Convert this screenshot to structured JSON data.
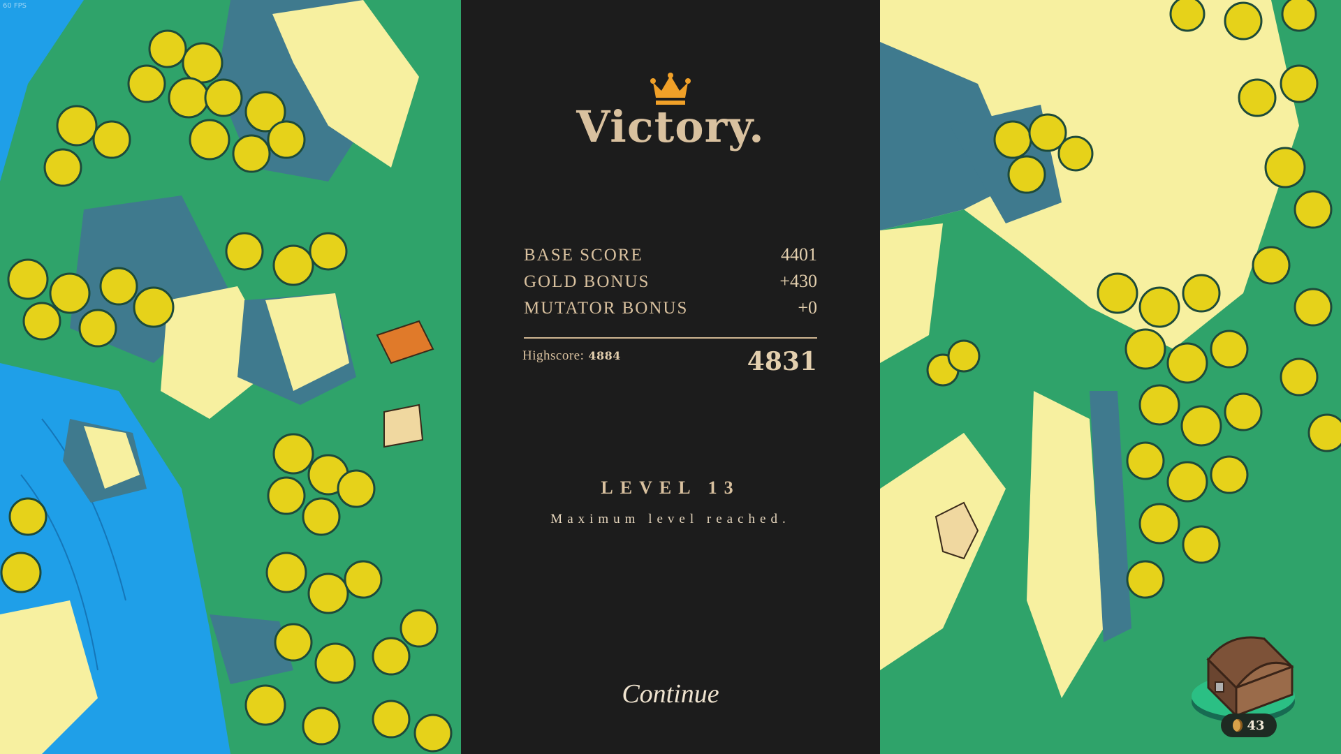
{
  "hud": {
    "fps_text": "60 FPS"
  },
  "results": {
    "title": "Victory.",
    "crown_icon": "crown-icon",
    "rows": [
      {
        "label": "BASE SCORE",
        "value": "4401"
      },
      {
        "label": "GOLD BONUS",
        "value": "+430"
      },
      {
        "label": "MUTATOR BONUS",
        "value": "+0"
      }
    ],
    "highscore_label": "Highscore:",
    "highscore_value": "4884",
    "total": "4831",
    "level_title": "LEVEL 13",
    "level_subtitle": "Maximum level reached.",
    "continue_label": "Continue"
  },
  "treasure": {
    "icon": "treasure-chest-icon",
    "gold_count": "43"
  },
  "colors": {
    "panel_bg": "#1c1c1c",
    "text_gold": "#d9c19f",
    "crown": "#f0a028",
    "grass": "#2fa36a",
    "water": "#1f9fe8",
    "rock_light": "#f7f0a0",
    "rock_dark": "#3f7a8e",
    "tree": "#e6d21a"
  }
}
